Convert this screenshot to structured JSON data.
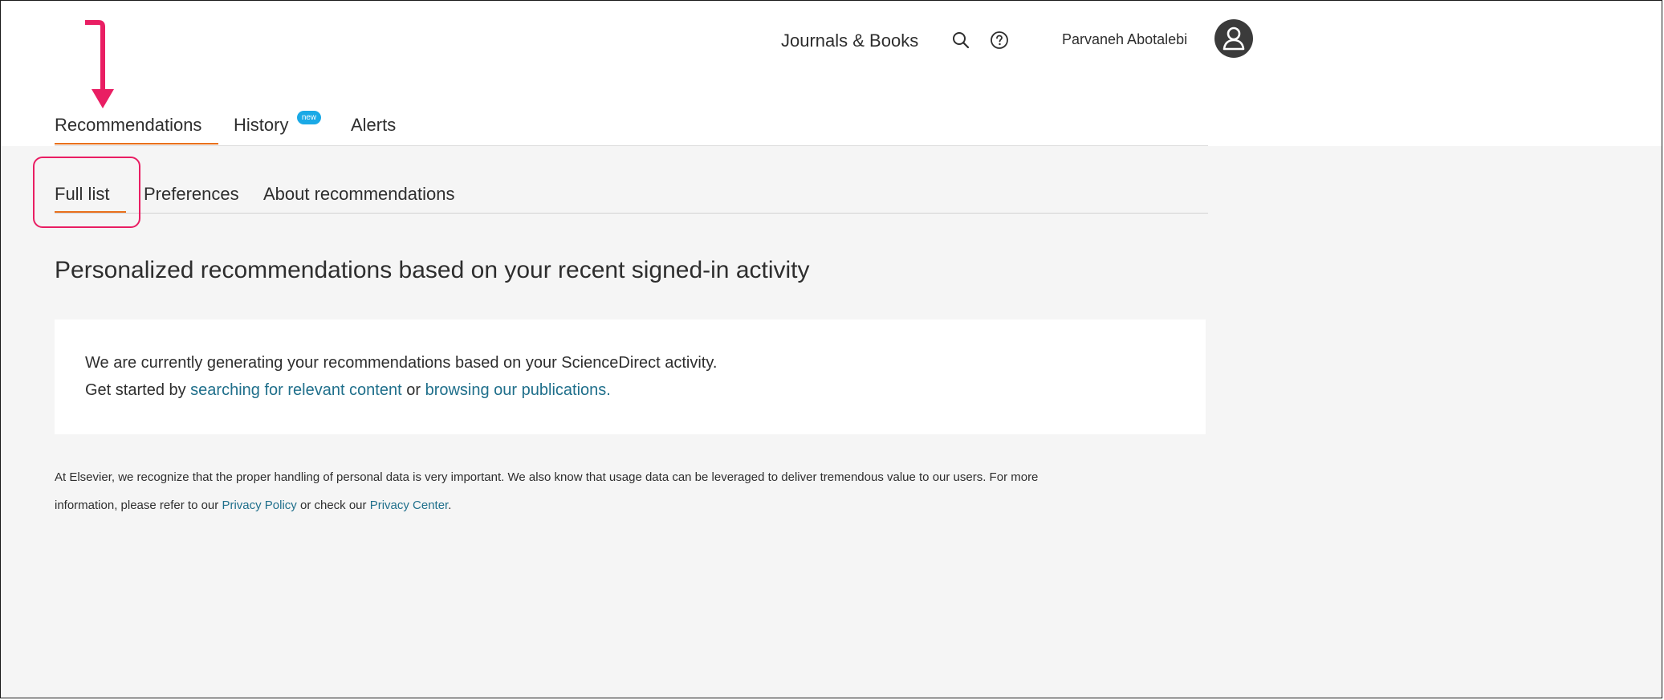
{
  "topbar": {
    "journals_books": "Journals & Books",
    "user_name": "Parvaneh Abotalebi"
  },
  "main_tabs": [
    {
      "label": "Recommendations",
      "active": true
    },
    {
      "label": "History",
      "badge": "new"
    },
    {
      "label": "Alerts"
    }
  ],
  "sub_tabs": [
    {
      "label": "Full list",
      "active": true
    },
    {
      "label": "Preferences"
    },
    {
      "label": "About recommendations"
    }
  ],
  "page_title": "Personalized recommendations based on your recent signed-in activity",
  "card": {
    "line1": "We are currently generating your recommendations based on your ScienceDirect activity.",
    "line2_prefix": "Get started by ",
    "link_search": "searching for relevant content",
    "line2_mid": " or ",
    "link_browse": "browsing our publications."
  },
  "footer": {
    "line1": "At Elsevier, we recognize that the proper handling of personal data is very important. We also know that usage data can be leveraged to deliver tremendous value to our users. For more",
    "line2_prefix": "information, please refer to our ",
    "privacy_policy": "Privacy Policy",
    "line2_mid": " or check our ",
    "privacy_center": "Privacy Center",
    "line2_suffix": "."
  },
  "colors": {
    "accent": "#e9711c",
    "annotation": "#e91e63",
    "link": "#1f6f8b",
    "badge": "#1aa9e6"
  },
  "icons": {
    "search": "search-icon",
    "help": "help-icon",
    "user": "user-avatar-icon"
  }
}
